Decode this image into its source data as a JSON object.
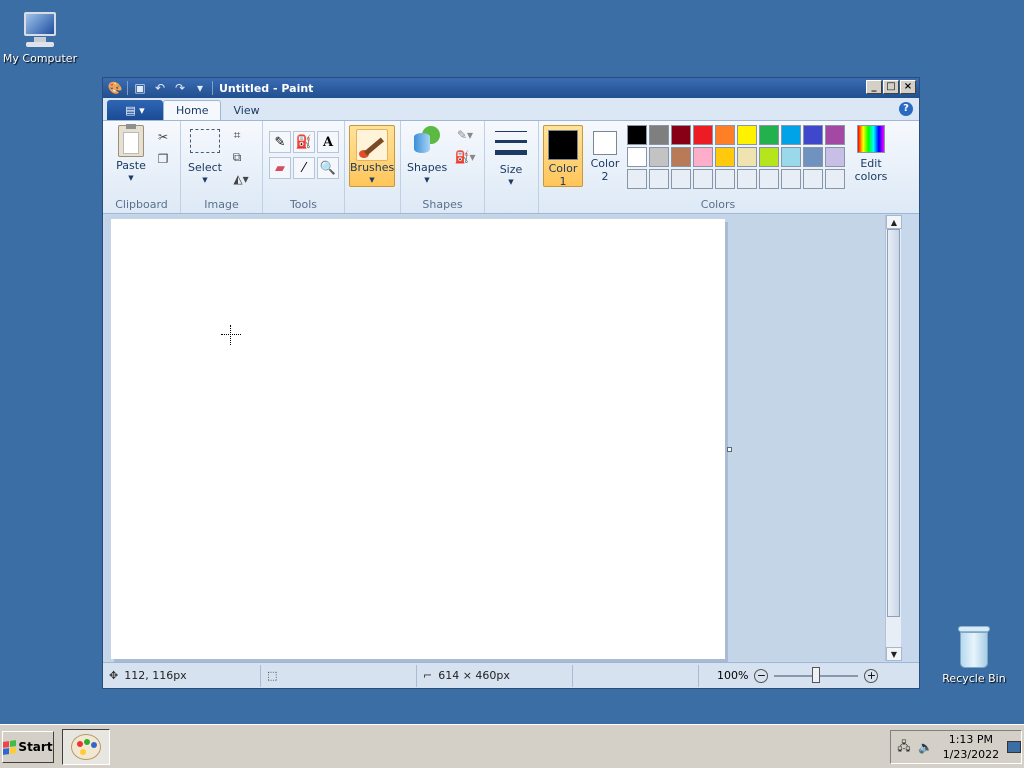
{
  "desktop": {
    "icons": [
      {
        "label": "My Computer",
        "icon": "computer-icon"
      },
      {
        "label": "Recycle Bin",
        "icon": "recycle-bin-icon"
      }
    ]
  },
  "window": {
    "title": "Untitled - Paint",
    "controls": {
      "minimize": "_",
      "maximize": "□",
      "close": "×"
    }
  },
  "ribbon": {
    "app_menu": "▤ ▾",
    "tabs": [
      {
        "label": "Home",
        "active": true
      },
      {
        "label": "View",
        "active": false
      }
    ],
    "groups": {
      "clipboard": {
        "label": "Clipboard",
        "paste": "Paste"
      },
      "image": {
        "label": "Image",
        "select": "Select"
      },
      "tools": {
        "label": "Tools"
      },
      "brushes": {
        "label": "Brushes"
      },
      "shapes": {
        "label": "Shapes",
        "shapes": "Shapes"
      },
      "size": {
        "label": "Size"
      },
      "colors": {
        "label": "Colors",
        "color1": {
          "label": "Color",
          "num": "1",
          "value": "#000000"
        },
        "color2": {
          "label": "Color",
          "num": "2",
          "value": "#ffffff"
        },
        "edit": {
          "line1": "Edit",
          "line2": "colors"
        },
        "palette_row1": [
          "#000000",
          "#7f7f7f",
          "#880015",
          "#ed1c24",
          "#ff7f27",
          "#fff200",
          "#22b14c",
          "#00a2e8",
          "#3f48cc",
          "#a349a4"
        ],
        "palette_row2": [
          "#ffffff",
          "#c3c3c3",
          "#b97a57",
          "#ffaec9",
          "#ffc90e",
          "#efe4b0",
          "#b5e61d",
          "#99d9ea",
          "#7092be",
          "#c8bfe7"
        ],
        "palette_row3": [
          "#e8eef6",
          "#e8eef6",
          "#e8eef6",
          "#e8eef6",
          "#e8eef6",
          "#e8eef6",
          "#e8eef6",
          "#e8eef6",
          "#e8eef6",
          "#e8eef6"
        ]
      }
    }
  },
  "statusbar": {
    "cursor_pos": "112, 116px",
    "selection_size": "",
    "image_size": "614 × 460px",
    "zoom": "100%"
  },
  "taskbar": {
    "start": "Start",
    "time": "1:13 PM",
    "date": "1/23/2022"
  }
}
